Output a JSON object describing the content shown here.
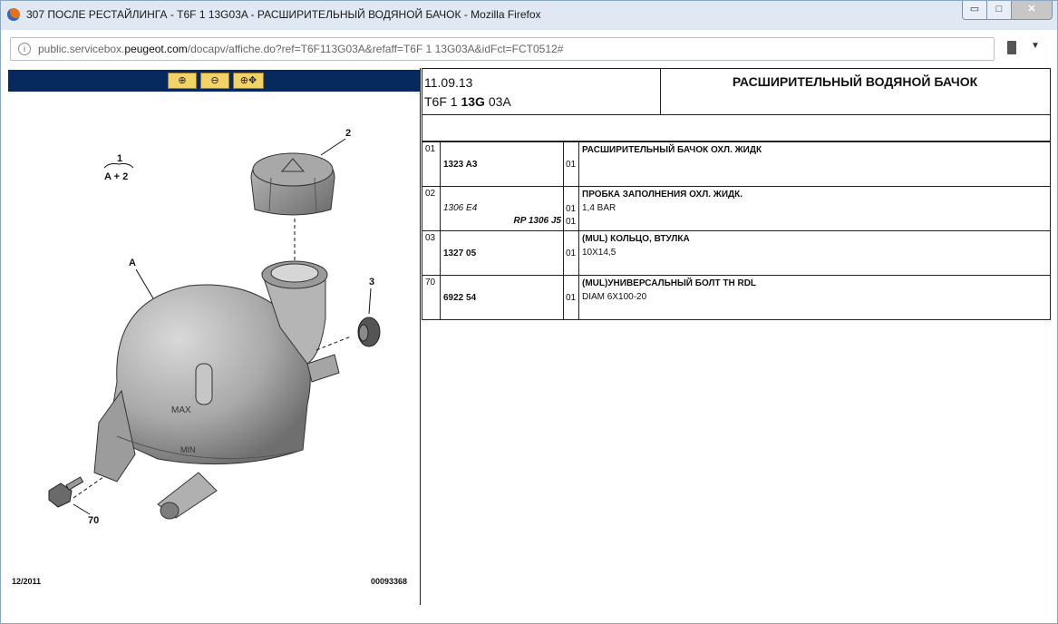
{
  "window": {
    "title": "307 ПОСЛЕ РЕСТАЙЛИНГА - T6F 1 13G03A - РАСШИРИТЕЛЬНЫЙ ВОДЯНОЙ БАЧОК - Mozilla Firefox",
    "controls": {
      "minimize": "▭",
      "maximize": "□",
      "close": "✕"
    }
  },
  "address_bar": {
    "url_prefix": "public.servicebox.",
    "url_domain": "peugeot.com",
    "url_suffix": "/docapv/affiche.do?ref=T6F113G03A&refaff=T6F 1 13G03A&idFct=FCT0512#"
  },
  "viewer": {
    "zoom_in": "⊕",
    "zoom_out": "⊖",
    "zoom_move": "⊕✥",
    "callouts": {
      "group": "1",
      "group_sub": "A + 2",
      "cap": "2",
      "tank": "A",
      "seal": "3",
      "bolt": "70"
    },
    "markings": {
      "max": "MAX",
      "min": "MIN"
    },
    "footer_left": "12/2011",
    "footer_right": "00093368"
  },
  "header": {
    "date": "11.09.13",
    "code_a": "T6F 1 ",
    "code_b": "13G",
    "code_c": " 03A",
    "title": "РАСШИРИТЕЛЬНЫЙ ВОДЯНОЙ БАЧОК"
  },
  "parts": [
    {
      "ref": "01",
      "part": "1323 A3",
      "part_italic": "",
      "alt": "",
      "qty": "01",
      "qty2": "",
      "name": "РАСШИРИТЕЛЬНЫЙ БАЧОК ОХЛ. ЖИДК",
      "spec": ""
    },
    {
      "ref": "02",
      "part": "",
      "part_italic": "1306 E4",
      "alt": "RP 1306 J5",
      "qty": "01",
      "qty2": "01",
      "name": "ПРОБКА ЗАПОЛНЕНИЯ ОХЛ. ЖИДК.",
      "spec": "1,4 BAR"
    },
    {
      "ref": "03",
      "part": "1327 05",
      "part_italic": "",
      "alt": "",
      "qty": "01",
      "qty2": "",
      "name": "(MUL) КОЛЬЦО, ВТУЛКА",
      "spec": "10X14,5"
    },
    {
      "ref": "70",
      "part": "6922 54",
      "part_italic": "",
      "alt": "",
      "qty": "01",
      "qty2": "",
      "name": "(MUL)УНИВЕРСАЛЬНЫЙ БОЛТ TH RDL",
      "spec": "DIAM 6X100-20"
    }
  ]
}
